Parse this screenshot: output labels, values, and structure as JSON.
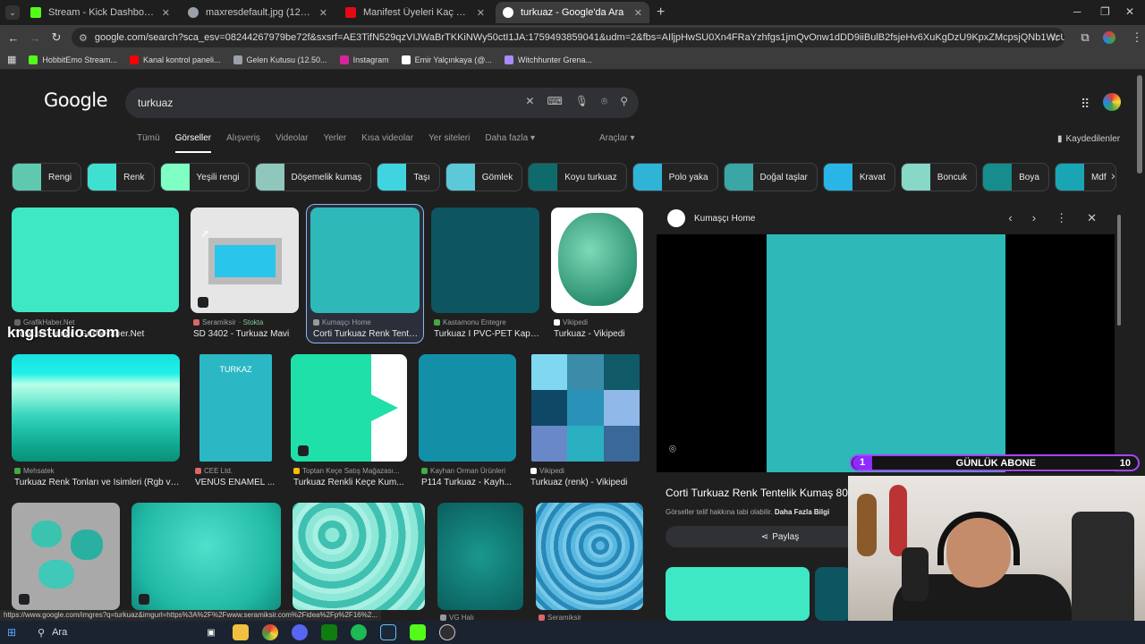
{
  "browser": {
    "tabs": [
      {
        "title": "Stream - Kick Dashboard",
        "color": "#53fc18"
      },
      {
        "title": "maxresdefault.jpg (1280×720)",
        "color": "#9aa0a6"
      },
      {
        "title": "Manifest Üyeleri Kaç Yaşında? |",
        "color": "#e50914"
      },
      {
        "title": "turkuaz - Google'da Ara",
        "color": "#ffffff"
      }
    ],
    "url": "google.com/search?sca_esv=08244267979be72f&sxsrf=AE3TifN529qzVIJWaBrTKKiNWy50ctI1JA:1759493859041&udm=2&fbs=AIljpHwSU0Xn4FRaYzhfgs1jmQvOnw1dDD9iiBulB2fsjeHv6XuKgDzU9KpxZMcpsjQNb1WcUrMDj8VH-V1nllcqw593vqMqjwCIqH...",
    "bookmarks": [
      {
        "label": "HobbitEmo Stream...",
        "color": "#53fc18"
      },
      {
        "label": "Kanal kontrol paneli...",
        "color": "#ff0000"
      },
      {
        "label": "Gelen Kutusu (12.50...",
        "color": "#9aa0a6"
      },
      {
        "label": "Instagram",
        "color": "#d6249f"
      },
      {
        "label": "Emir Yalçınkaya (@...",
        "color": "#ffffff"
      },
      {
        "label": "Witchhunter Grena...",
        "color": "#a78bfa"
      }
    ]
  },
  "google": {
    "logo": "Google",
    "query": "turkuaz",
    "nav_tabs": [
      "Tümü",
      "Görseller",
      "Alışveriş",
      "Videolar",
      "Yerler",
      "Kısa videolar",
      "Yer siteleri",
      "Daha fazla ▾"
    ],
    "tools": "Araçlar ▾",
    "saved": "Kaydedilenler",
    "chips": [
      {
        "label": "Rengi",
        "color": "#5fc9b0"
      },
      {
        "label": "Renk",
        "color": "#40e0d0"
      },
      {
        "label": "Yeşili rengi",
        "color": "#7fffc4"
      },
      {
        "label": "Döşemelik kumaş",
        "color": "#8fc7bd"
      },
      {
        "label": "Taşı",
        "color": "#3fd4e0"
      },
      {
        "label": "Gömlek",
        "color": "#5cc8d8"
      },
      {
        "label": "Koyu turkuaz",
        "color": "#0f6b6b"
      },
      {
        "label": "Polo yaka",
        "color": "#2fb4d8"
      },
      {
        "label": "Doğal taşlar",
        "color": "#3aa6a6"
      },
      {
        "label": "Kravat",
        "color": "#29b6e6"
      },
      {
        "label": "Boncuk",
        "color": "#88d8c8"
      },
      {
        "label": "Boya",
        "color": "#168c8c"
      },
      {
        "label": "Mdf",
        "color": "#1aa5b5"
      }
    ],
    "row1": [
      {
        "source": "GrafikHaber.Net",
        "caption": "Turkuaz Rengi - GrafikHaber.Net",
        "color": "#3ee8c4"
      },
      {
        "source": "Seramiksir",
        "stock": "· Stokta",
        "caption": "SD 3402 - Turkuaz Mavi",
        "color": "#29c5ea"
      },
      {
        "source": "Kumaşçı Home",
        "caption": "Corti Turkuaz Renk Tentelik...",
        "color": "#2eb8b8"
      },
      {
        "source": "Kastamonu Entegre",
        "caption": "Turkuaz I PVC-PET Kaplı...",
        "color": "#0d5560"
      },
      {
        "source": "Vikipedi",
        "caption": "Turkuaz - Vikipedi",
        "color": "#3fa88a"
      }
    ],
    "row2": [
      {
        "source": "Mehsatek",
        "caption": "Turkuaz Renk Tonları ve İsimleri (Rgb ve...",
        "color": "#18e0e0"
      },
      {
        "source": "CEE Ltd.",
        "caption": "VENÜS ENAMEL ...",
        "color": "#2bb8c4",
        "label": "TURKAZ"
      },
      {
        "source": "Toptan Keçe Satış Mağazası...",
        "caption": "Turkuaz Renkli Keçe Kum...",
        "color": "#1fe0a8"
      },
      {
        "source": "Kayhan Orman Ürünleri",
        "caption": "P114 Turkuaz - Kayh...",
        "color": "#1390a8"
      },
      {
        "source": "Vikipedi",
        "caption": "Turkuaz (renk) - Vikipedi",
        "color": "#2b8fa8"
      }
    ],
    "row3": [
      {
        "source": "",
        "color": "#3ac4b0"
      },
      {
        "source": "",
        "color": "#2cc4b0"
      },
      {
        "source": "",
        "color": "#58d0c0"
      },
      {
        "source": "VG Halı",
        "color": "#0f7a78"
      },
      {
        "source": "Seramiksir",
        "color": "#3aa8d0"
      }
    ]
  },
  "panel": {
    "source": "Kumaşçı Home",
    "title": "Corti Turkuaz Renk Tentelik Kumaş 800",
    "note": "Görseller telif hakkına tabi olabilir.",
    "note_link": "Daha Fazla Bilgi",
    "share": "Paylaş"
  },
  "overlay": {
    "num": "1",
    "label": "GÜNLÜK ABONE",
    "count": "10"
  },
  "watermark": "knglstudio.com",
  "status_url": "https://www.google.com/imgres?q=turkuaz&imgurl=https%3A%2F%2Fwww.seramiksir.com%2Fidea%2Fp%2F16%2...",
  "taskbar": {
    "search": "Ara"
  }
}
